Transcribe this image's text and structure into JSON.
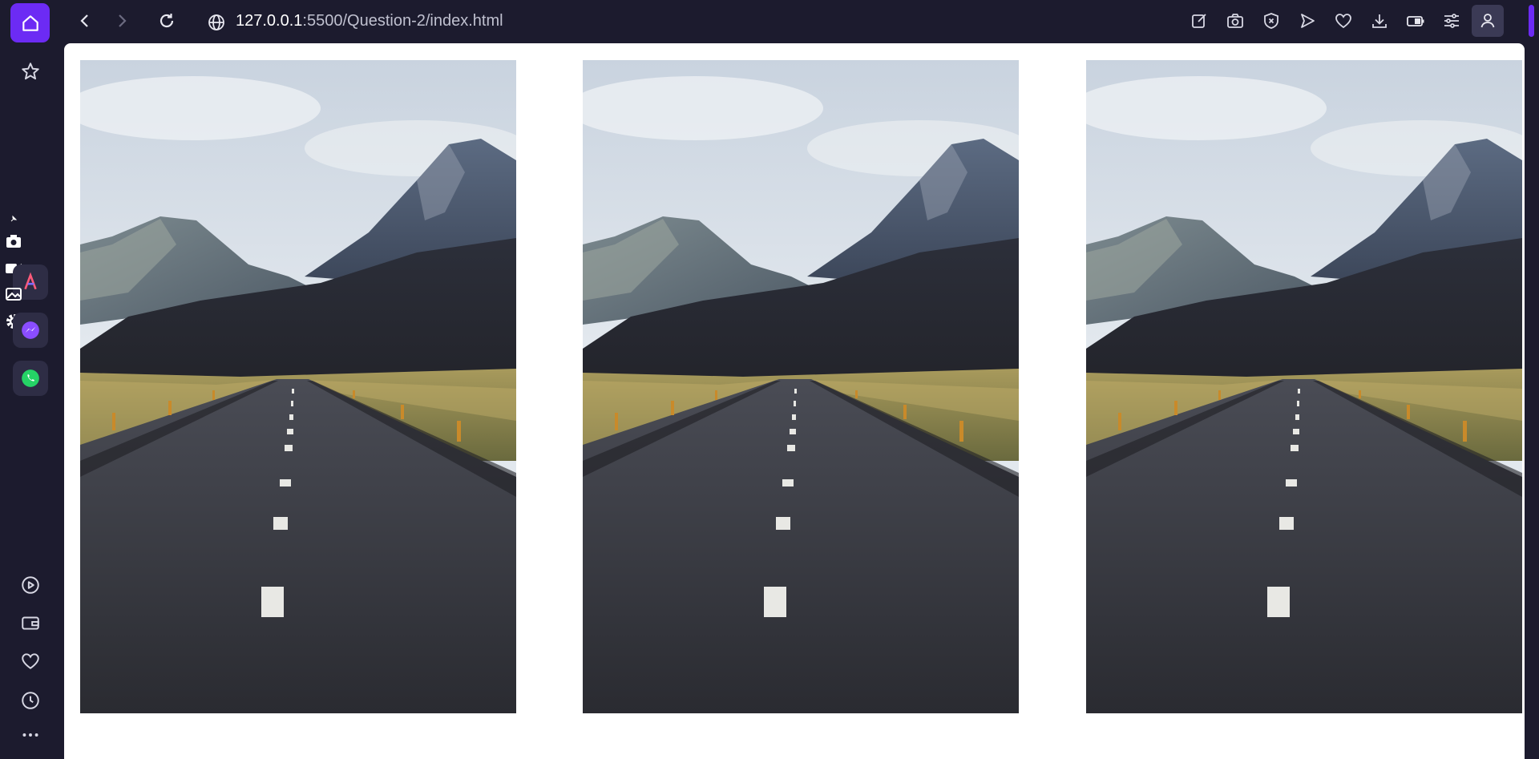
{
  "browser": {
    "url_host": "127.0.0.1",
    "url_rest": ":5500/Question-2/index.html",
    "toolbar_icons": [
      "back-icon",
      "forward-icon",
      "reload-icon",
      "globe-icon",
      "edit-icon",
      "camera-icon",
      "shield-x-icon",
      "send-icon",
      "heart-icon",
      "download-icon",
      "battery-icon",
      "tune-icon",
      "profile-icon"
    ],
    "sidebar_icons": [
      "home-icon",
      "star-icon",
      "camera-icon",
      "video-icon",
      "gallery-icon",
      "settings-icon",
      "aria-app-icon",
      "messenger-app-icon",
      "whatsapp-app-icon",
      "player-icon",
      "wallet-icon",
      "heart-icon",
      "history-icon",
      "more-icon"
    ],
    "accent_color": "#6c2bf4"
  },
  "page": {
    "images": [
      {
        "alt": "Road to mountains",
        "subject": "road-mountains"
      },
      {
        "alt": "Road to mountains",
        "subject": "road-mountains"
      },
      {
        "alt": "Road to mountains",
        "subject": "road-mountains"
      }
    ]
  }
}
